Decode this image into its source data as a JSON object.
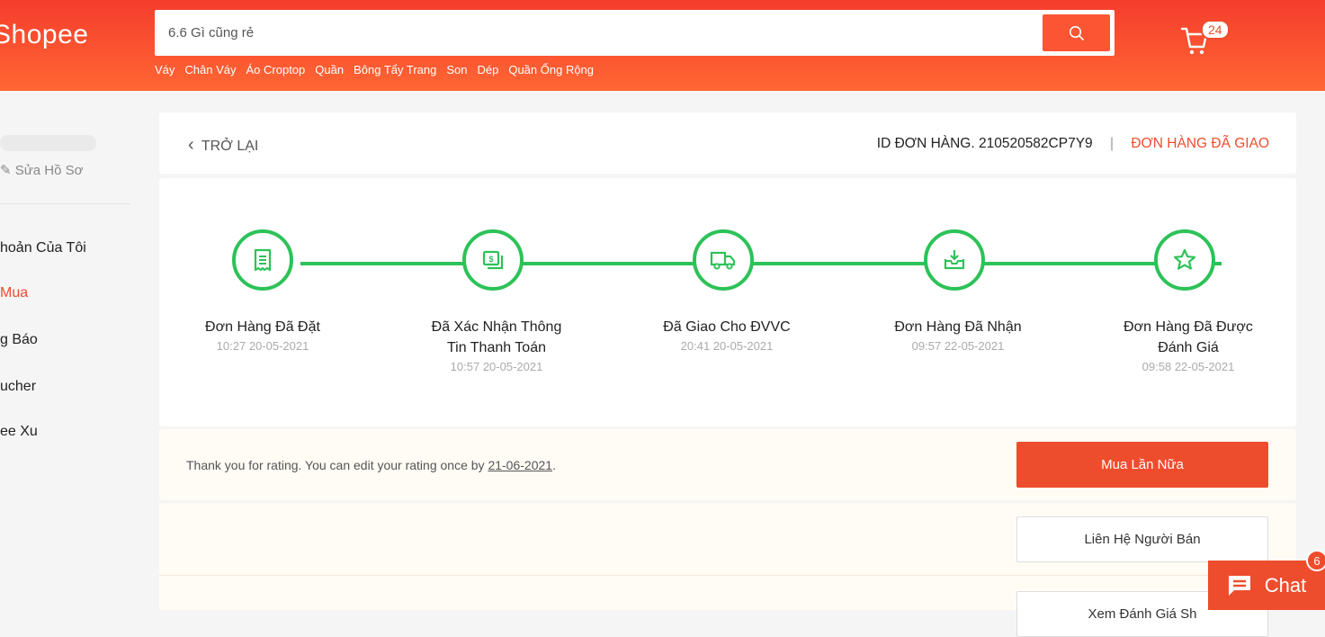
{
  "header": {
    "logo": "Shopee",
    "search": {
      "value": "6.6 Gì cũng rẻ"
    },
    "suggestions": [
      "Váy",
      "Chân Váy",
      "Áo Croptop",
      "Quần",
      "Bông Tẩy Trang",
      "Son",
      "Dép",
      "Quần Ống Rộng"
    ],
    "cart_count": "24"
  },
  "sidebar": {
    "edit_profile": "Sửa Hồ Sơ",
    "items": [
      {
        "label": "hoản Của Tôi",
        "active": false
      },
      {
        "label": "Mua",
        "active": true
      },
      {
        "label": "g Báo",
        "active": false
      },
      {
        "label": "ucher",
        "active": false
      },
      {
        "label": "ee Xu",
        "active": false
      }
    ]
  },
  "order": {
    "back_label": "TRỞ LẠI",
    "id_label": "ID ĐƠN HÀNG. 210520582CP7Y9",
    "separator": "|",
    "status": "ĐƠN HÀNG ĐÃ GIAO"
  },
  "steps": [
    {
      "title": "Đơn Hàng Đã Đặt",
      "time": "10:27 20-05-2021",
      "icon": "receipt-icon"
    },
    {
      "title": "Đã Xác Nhận Thông Tin Thanh Toán",
      "time": "10:57 20-05-2021",
      "icon": "money-icon"
    },
    {
      "title": "Đã Giao Cho ĐVVC",
      "time": "20:41 20-05-2021",
      "icon": "truck-icon"
    },
    {
      "title": "Đơn Hàng Đã Nhận",
      "time": "09:57 22-05-2021",
      "icon": "inbox-download-icon"
    },
    {
      "title": "Đơn Hàng Đã Được Đánh Giá",
      "time": "09:58 22-05-2021",
      "icon": "star-icon"
    }
  ],
  "rating": {
    "text": "Thank you for rating. You can edit your rating once by",
    "date": "21-06-2021",
    "period": "."
  },
  "actions": {
    "buy_again": "Mua Lần Nữa",
    "contact_seller": "Liên Hệ Người Bán",
    "view_rating": "Xem Đánh Giá Sh"
  },
  "chat": {
    "label": "Chat",
    "badge": "6"
  },
  "colors": {
    "brand": "#ee4d2d",
    "success": "#2dc258"
  }
}
